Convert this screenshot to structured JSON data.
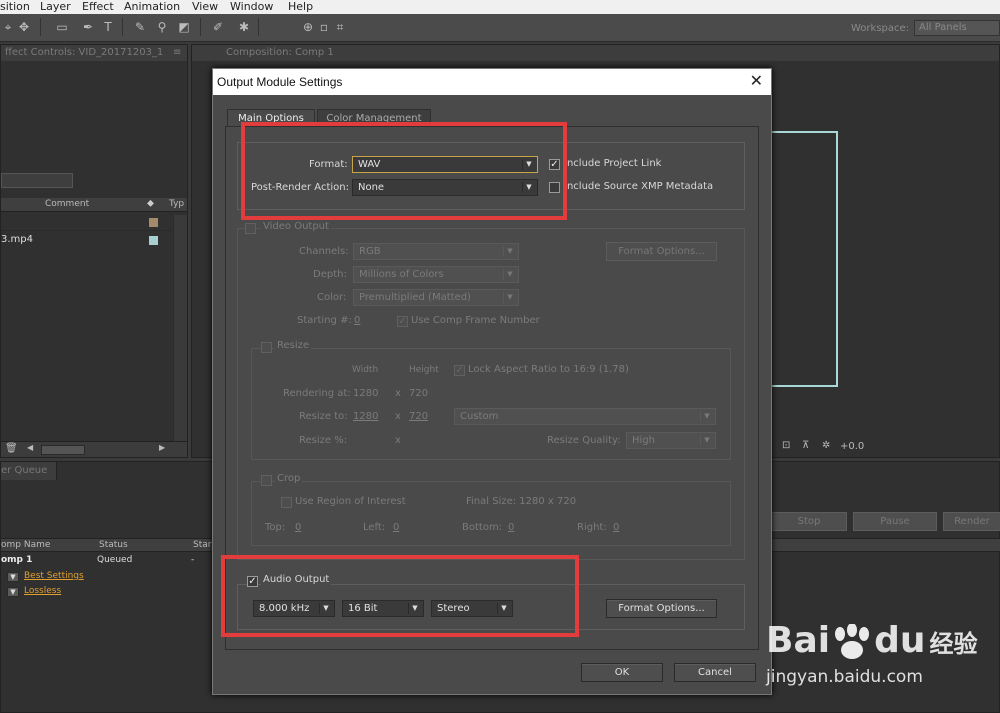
{
  "menu": [
    "sition",
    "Layer",
    "Effect",
    "Animation",
    "View",
    "Window",
    "Help"
  ],
  "workspace": {
    "label": "Workspace:",
    "value": "All Panels"
  },
  "effect_controls": {
    "title": "ffect Controls: VID_20171203_1",
    "menu": "≡"
  },
  "project": {
    "col_comment": "Comment",
    "col_type": "Typ",
    "row1": "3.mp4"
  },
  "composition": {
    "title": "Composition: Comp 1",
    "zoom_value": "+0.0"
  },
  "render_queue": {
    "tab": "er Queue",
    "stop": "Stop",
    "pause": "Pause",
    "render": "Render",
    "col_name": "omp Name",
    "col_status": "Status",
    "col_started": "Start",
    "row_name": "omp 1",
    "row_status": "Queued",
    "row_started": "-",
    "settings_link": "Best Settings",
    "output_link": "Lossless"
  },
  "dialog": {
    "title": "Output Module Settings",
    "close": "✕",
    "tabs": {
      "main": "Main Options",
      "color": "Color Management"
    },
    "format_label": "Format:",
    "format_value": "WAV",
    "post_render_label": "Post-Render Action:",
    "post_render_value": "None",
    "include_project_link": "Include Project Link",
    "include_source_xmp": "Include Source XMP Metadata",
    "video_output": "Video Output",
    "channels_label": "Channels:",
    "channels_value": "RGB",
    "depth_label": "Depth:",
    "depth_value": "Millions of Colors",
    "color_label": "Color:",
    "color_value": "Premultiplied (Matted)",
    "starting_label": "Starting #:",
    "starting_value": "0",
    "use_comp_frame": "Use Comp Frame Number",
    "format_options_video": "Format Options...",
    "resize": "Resize",
    "width_head": "Width",
    "height_head": "Height",
    "lock_aspect": "Lock Aspect Ratio to 16:9 (1.78)",
    "rendering_at_label": "Rendering at:",
    "rendering_w": "1280",
    "rendering_h": "720",
    "resize_to_label": "Resize to:",
    "resize_to_w": "1280",
    "resize_to_h": "720",
    "resize_preset": "Custom",
    "resize_pct_label": "Resize %:",
    "times": "x",
    "resize_quality_label": "Resize Quality:",
    "resize_quality_value": "High",
    "crop": "Crop",
    "use_roi": "Use Region of Interest",
    "final_size": "Final Size: 1280 x 720",
    "top_label": "Top:",
    "top_value": "0",
    "left_label": "Left:",
    "left_value": "0",
    "bottom_label": "Bottom:",
    "bottom_value": "0",
    "right_label": "Right:",
    "right_value": "0",
    "audio_output": "Audio Output",
    "sample_rate": "8.000 kHz",
    "bit_depth": "16 Bit",
    "channels_audio": "Stereo",
    "format_options_audio": "Format Options...",
    "ok": "OK",
    "cancel": "Cancel"
  },
  "watermark": {
    "brand_1": "Bai",
    "brand_2": "du",
    "brand_cn": "经验",
    "url": "jingyan.baidu.com"
  },
  "colors": {
    "highlight": "#e33c3c",
    "dialog_bg": "#4a4a4a",
    "link": "#e0a030"
  }
}
